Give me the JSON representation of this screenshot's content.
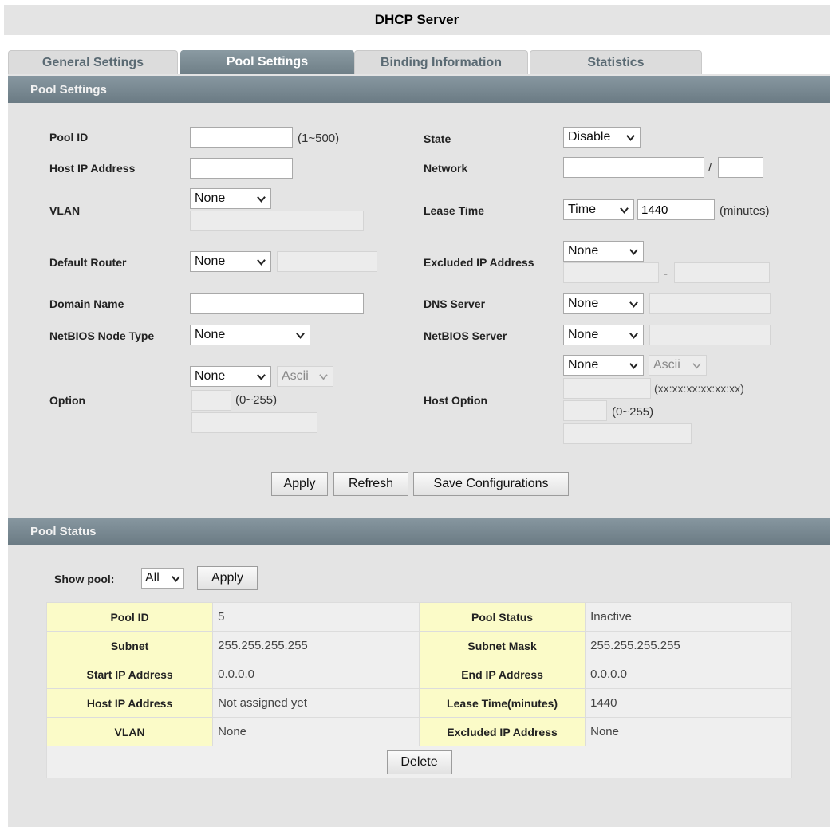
{
  "window": {
    "title": "DHCP Server"
  },
  "tabs": [
    {
      "label": "General Settings",
      "active": false
    },
    {
      "label": "Pool Settings",
      "active": true
    },
    {
      "label": "Binding Information",
      "active": false
    },
    {
      "label": "Statistics",
      "active": false
    }
  ],
  "pool_settings": {
    "heading": "Pool Settings",
    "pool_id": {
      "label": "Pool ID",
      "value": "",
      "hint": "(1~500)"
    },
    "host_ip": {
      "label": "Host IP Address",
      "value": ""
    },
    "vlan": {
      "label": "VLAN",
      "selected": "None",
      "value": ""
    },
    "default_router": {
      "label": "Default Router",
      "selected": "None",
      "value": ""
    },
    "domain_name": {
      "label": "Domain Name",
      "value": ""
    },
    "netbios_node_type": {
      "label": "NetBIOS Node Type",
      "selected": "None"
    },
    "option": {
      "label": "Option",
      "selected": "None",
      "encoding": "Ascii",
      "code": "",
      "code_hint": "(0~255)",
      "value": ""
    },
    "state": {
      "label": "State",
      "selected": "Disable"
    },
    "network": {
      "label": "Network",
      "value": "",
      "separator": "/",
      "prefix": ""
    },
    "lease_time": {
      "label": "Lease Time",
      "selected": "Time",
      "value": "1440",
      "unit": "(minutes)"
    },
    "excluded_ip": {
      "label": "Excluded IP Address",
      "selected": "None",
      "start": "",
      "separator": "-",
      "end": ""
    },
    "dns_server": {
      "label": "DNS Server",
      "selected": "None",
      "value": ""
    },
    "netbios_server": {
      "label": "NetBIOS Server",
      "selected": "None",
      "value": ""
    },
    "host_option": {
      "label": "Host Option",
      "selected": "None",
      "encoding": "Ascii",
      "mac": "",
      "mac_hint": "(xx:xx:xx:xx:xx:xx)",
      "code": "",
      "code_hint": "(0~255)",
      "value": ""
    },
    "buttons": {
      "apply": "Apply",
      "refresh": "Refresh",
      "save": "Save Configurations"
    }
  },
  "pool_status": {
    "heading": "Pool Status",
    "show_pool_label": "Show pool:",
    "show_pool_selected": "All",
    "apply": "Apply",
    "rows": [
      {
        "k1": "Pool ID",
        "v1": "5",
        "k2": "Pool Status",
        "v2": "Inactive"
      },
      {
        "k1": "Subnet",
        "v1": "255.255.255.255",
        "k2": "Subnet Mask",
        "v2": "255.255.255.255"
      },
      {
        "k1": "Start IP Address",
        "v1": "0.0.0.0",
        "k2": "End IP Address",
        "v2": "0.0.0.0"
      },
      {
        "k1": "Host IP Address",
        "v1": "Not assigned yet",
        "k2": "Lease Time(minutes)",
        "v2": "1440"
      },
      {
        "k1": "VLAN",
        "v1": "None",
        "k2": "Excluded IP Address",
        "v2": "None"
      }
    ],
    "delete": "Delete"
  },
  "icons": {
    "dropdown": "chevron-down-icon"
  }
}
